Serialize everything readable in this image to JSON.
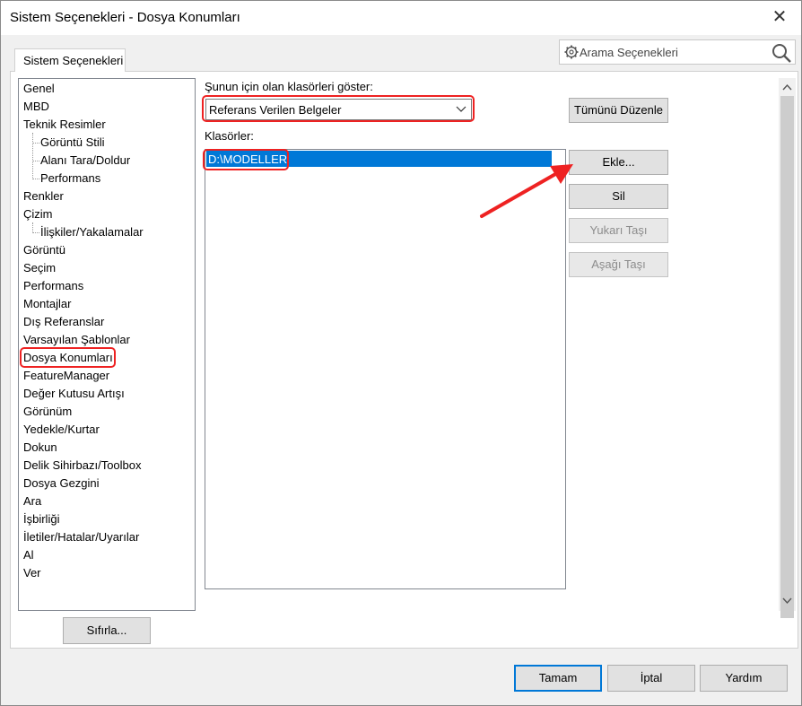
{
  "window": {
    "title": "Sistem Seçenekleri - Dosya Konumları",
    "close_glyph": "✕"
  },
  "tab": {
    "label": "Sistem Seçenekleri"
  },
  "search": {
    "placeholder": "Arama Seçenekleri"
  },
  "tree": {
    "items": [
      {
        "label": "Genel"
      },
      {
        "label": "MBD"
      },
      {
        "label": "Teknik Resimler"
      },
      {
        "label": "Görüntü Stili"
      },
      {
        "label": "Alanı Tara/Doldur"
      },
      {
        "label": "Performans"
      },
      {
        "label": "Renkler"
      },
      {
        "label": "Çizim"
      },
      {
        "label": "İlişkiler/Yakalamalar"
      },
      {
        "label": "Görüntü"
      },
      {
        "label": "Seçim"
      },
      {
        "label": "Performans"
      },
      {
        "label": "Montajlar"
      },
      {
        "label": "Dış Referanslar"
      },
      {
        "label": "Varsayılan Şablonlar"
      },
      {
        "label": "Dosya Konumları"
      },
      {
        "label": "FeatureManager"
      },
      {
        "label": "Değer Kutusu Artışı"
      },
      {
        "label": "Görünüm"
      },
      {
        "label": "Yedekle/Kurtar"
      },
      {
        "label": "Dokun"
      },
      {
        "label": "Delik Sihirbazı/Toolbox"
      },
      {
        "label": "Dosya Gezgini"
      },
      {
        "label": "Ara"
      },
      {
        "label": "İşbirliği"
      },
      {
        "label": "İletiler/Hatalar/Uyarılar"
      },
      {
        "label": "Al"
      },
      {
        "label": "Ver"
      }
    ],
    "selected": "Dosya Konumları"
  },
  "reset_button": "Sıfırla...",
  "show_folders": {
    "label": "Şunun için olan klasörleri göster:",
    "selected": "Referans Verilen Belgeler"
  },
  "folders": {
    "label": "Klasörler:",
    "items": [
      "D:\\MODELLER"
    ]
  },
  "buttons": {
    "edit_all": "Tümünü Düzenle",
    "add": "Ekle...",
    "delete": "Sil",
    "move_up": "Yukarı Taşı",
    "move_down": "Aşağı Taşı"
  },
  "footer": {
    "ok": "Tamam",
    "cancel": "İptal",
    "help": "Yardım"
  },
  "colors": {
    "highlight": "#e22222",
    "selection": "#0078d7"
  }
}
